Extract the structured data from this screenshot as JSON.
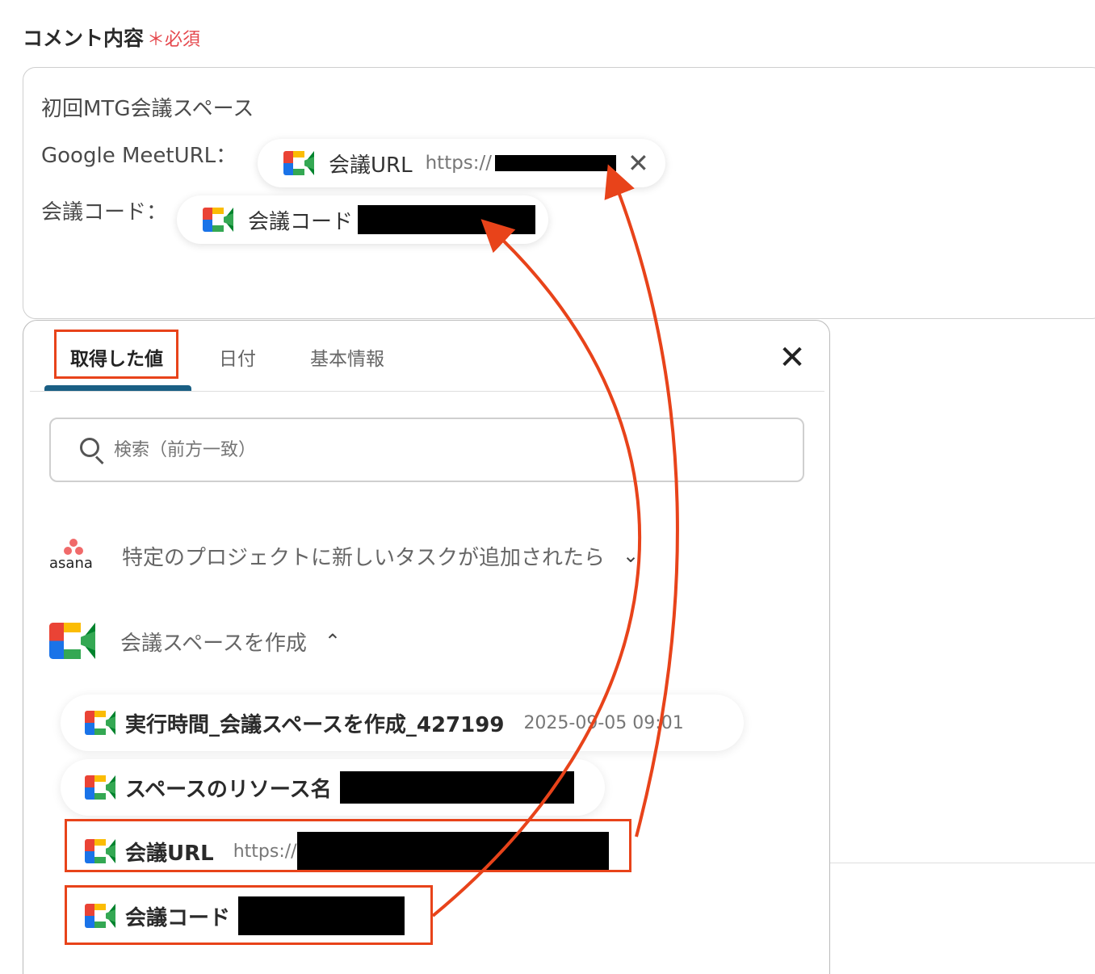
{
  "field": {
    "label": "コメント内容",
    "required_mark": "＊必須"
  },
  "editor": {
    "line1": "初回MTG会議スペース",
    "line2_label": "Google MeetURL：",
    "line3_label": "会議コード：",
    "chip_url": {
      "label": "会議URL",
      "value": "https://",
      "remove": "✕"
    },
    "chip_code": {
      "label": "会議コード"
    }
  },
  "panel": {
    "tabs": [
      "取得した値",
      "日付",
      "基本情報"
    ],
    "close": "✕",
    "search_placeholder": "検索（前方一致）",
    "sections": [
      {
        "app": "asana",
        "title": "特定のプロジェクトに新しいタスクが追加されたら",
        "chevron": "⌄"
      },
      {
        "app": "google-meet",
        "title": "会議スペースを作成",
        "chevron": "⌃"
      }
    ],
    "rows": [
      {
        "label": "実行時間_会議スペースを作成_427199",
        "value": "2025-09-05 09:01"
      },
      {
        "label": "スペースのリソース名",
        "value": ""
      },
      {
        "label": "会議URL",
        "value": "https://"
      },
      {
        "label": "会議コード",
        "value": ""
      }
    ]
  },
  "colors": {
    "accent_red": "#e8431a",
    "tab_underline": "#1a5f84",
    "required": "#e5484d"
  },
  "icons": [
    "google-meet-icon",
    "asana-logo",
    "search-icon",
    "close-icon",
    "chevron-down-icon",
    "chevron-up-icon"
  ]
}
